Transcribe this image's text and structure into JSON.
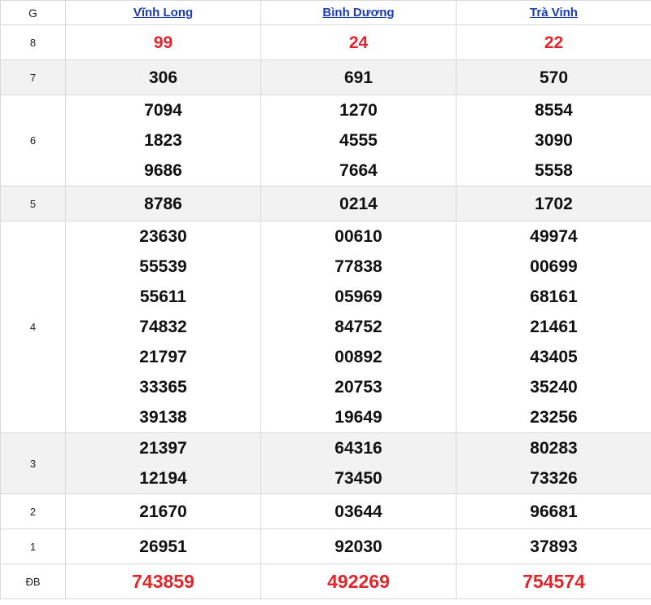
{
  "header": {
    "prize_label": "G",
    "provinces": [
      "Vĩnh Long",
      "Bình Dương",
      "Trà Vinh"
    ]
  },
  "rows": [
    {
      "prize": "8",
      "alt": false,
      "style": "red",
      "cols": [
        [
          "99"
        ],
        [
          "24"
        ],
        [
          "22"
        ]
      ]
    },
    {
      "prize": "7",
      "alt": true,
      "style": "",
      "cols": [
        [
          "306"
        ],
        [
          "691"
        ],
        [
          "570"
        ]
      ]
    },
    {
      "prize": "6",
      "alt": false,
      "style": "",
      "cols": [
        [
          "7094",
          "1823",
          "9686"
        ],
        [
          "1270",
          "4555",
          "7664"
        ],
        [
          "8554",
          "3090",
          "5558"
        ]
      ]
    },
    {
      "prize": "5",
      "alt": true,
      "style": "",
      "cols": [
        [
          "8786"
        ],
        [
          "0214"
        ],
        [
          "1702"
        ]
      ]
    },
    {
      "prize": "4",
      "alt": false,
      "style": "",
      "cols": [
        [
          "23630",
          "55539",
          "55611",
          "74832",
          "21797",
          "33365",
          "39138"
        ],
        [
          "00610",
          "77838",
          "05969",
          "84752",
          "00892",
          "20753",
          "19649"
        ],
        [
          "49974",
          "00699",
          "68161",
          "21461",
          "43405",
          "35240",
          "23256"
        ]
      ]
    },
    {
      "prize": "3",
      "alt": true,
      "style": "",
      "cols": [
        [
          "21397",
          "12194"
        ],
        [
          "64316",
          "73450"
        ],
        [
          "80283",
          "73326"
        ]
      ]
    },
    {
      "prize": "2",
      "alt": false,
      "style": "",
      "cols": [
        [
          "21670"
        ],
        [
          "03644"
        ],
        [
          "96681"
        ]
      ]
    },
    {
      "prize": "1",
      "alt": false,
      "style": "",
      "cols": [
        [
          "26951"
        ],
        [
          "92030"
        ],
        [
          "37893"
        ]
      ]
    },
    {
      "prize": "ĐB",
      "alt": false,
      "style": "red big",
      "cols": [
        [
          "743859"
        ],
        [
          "492269"
        ],
        [
          "754574"
        ]
      ]
    }
  ]
}
